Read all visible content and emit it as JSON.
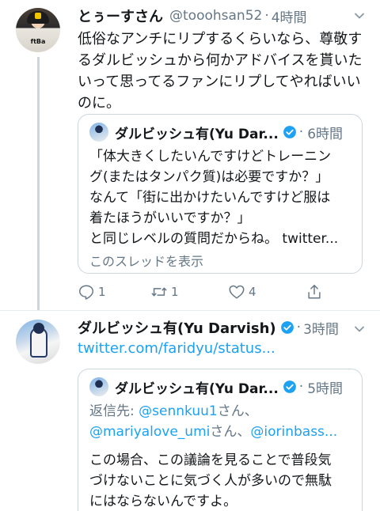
{
  "tweet1": {
    "name": "とぅーすさん",
    "handle": "@tooohsan52",
    "time": "4時間",
    "text": "低俗なアンチにリプするくらいなら、尊敬するダルビッシュから何かアドバイスを貰いたいって思ってるファンにリプしてやればいいのに。",
    "quote": {
      "name": "ダルビッシュ有(Yu Dar...",
      "time": "6時間",
      "lines": [
        "「体大きくしたいんですけどトレーニン",
        "グ(またはタンパク質)は必要ですか？」",
        "なんて「街に出かけたいんですけど服は",
        "着たほうがいいですか？」",
        "と同じレベルの質問だからね。 twitter..."
      ],
      "show_thread": "このスレッドを表示"
    },
    "actions": {
      "reply_count": "1",
      "retweet_count": "1",
      "like_count": "4"
    }
  },
  "tweet2": {
    "name": "ダルビッシュ有(Yu Darvish)",
    "time": "3時間",
    "link": "twitter.com/faridyu/status...",
    "quote": {
      "name": "ダルビッシュ有(Yu Dar...",
      "time": "5時間",
      "reply_prefix": "返信先: ",
      "mention1": "@sennkuu1",
      "suffix1": "さん、",
      "mention2": "@mariyalove_umi",
      "suffix2": "さん、",
      "mention3": "@iorinbass...",
      "lines": [
        "この場合、この議論を見ることで普段気",
        "づけないことに気づく人が多いので無駄",
        "にはならないんですよ。"
      ]
    }
  },
  "colors": {
    "accent": "#1da1f2",
    "secondary_text": "#657786",
    "border": "#ccd6dd"
  }
}
